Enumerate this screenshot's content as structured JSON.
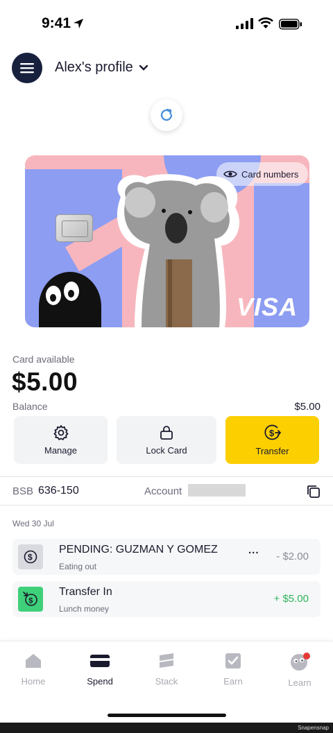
{
  "status_bar": {
    "time": "9:41"
  },
  "header": {
    "profile_name": "Alex's profile"
  },
  "card": {
    "card_numbers_label": "Card numbers",
    "network": "VISA"
  },
  "balance": {
    "available_label": "Card available",
    "available_amount": "$5.00",
    "balance_label": "Balance",
    "balance_amount": "$5.00"
  },
  "actions": [
    {
      "label": "Manage",
      "icon": "gear-icon"
    },
    {
      "label": "Lock Card",
      "icon": "lock-icon"
    },
    {
      "label": "Transfer",
      "icon": "transfer-dollar-icon"
    }
  ],
  "account": {
    "bsb_label": "BSB",
    "bsb_value": "636-150",
    "account_label": "Account",
    "account_value_hidden": true
  },
  "transactions_date": "Wed 30 Jul",
  "transactions": [
    {
      "title": "PENDING: GUZMAN Y GOMEZ",
      "subtitle": "Eating out",
      "amount": "- $2.00",
      "more": "...",
      "icon": "dollar-icon",
      "amount_color": "#8a8a95"
    },
    {
      "title": "Transfer In",
      "subtitle": "Lunch money",
      "amount": "+ $5.00",
      "icon": "dollar-in-icon",
      "amount_color": "#2fb35a"
    }
  ],
  "tabs": [
    {
      "label": "Home",
      "icon": "home-icon",
      "active": false
    },
    {
      "label": "Spend",
      "icon": "card-icon",
      "active": true
    },
    {
      "label": "Stack",
      "icon": "stack-icon",
      "active": false
    },
    {
      "label": "Earn",
      "icon": "check-box-icon",
      "active": false
    },
    {
      "label": "Learn",
      "icon": "learn-face-icon",
      "active": false,
      "badge": true
    }
  ],
  "colors": {
    "accent_yellow": "#fccf00",
    "navy": "#17203d",
    "notification": "#e53935"
  },
  "footer": {
    "watermark": "Snapensnap"
  }
}
